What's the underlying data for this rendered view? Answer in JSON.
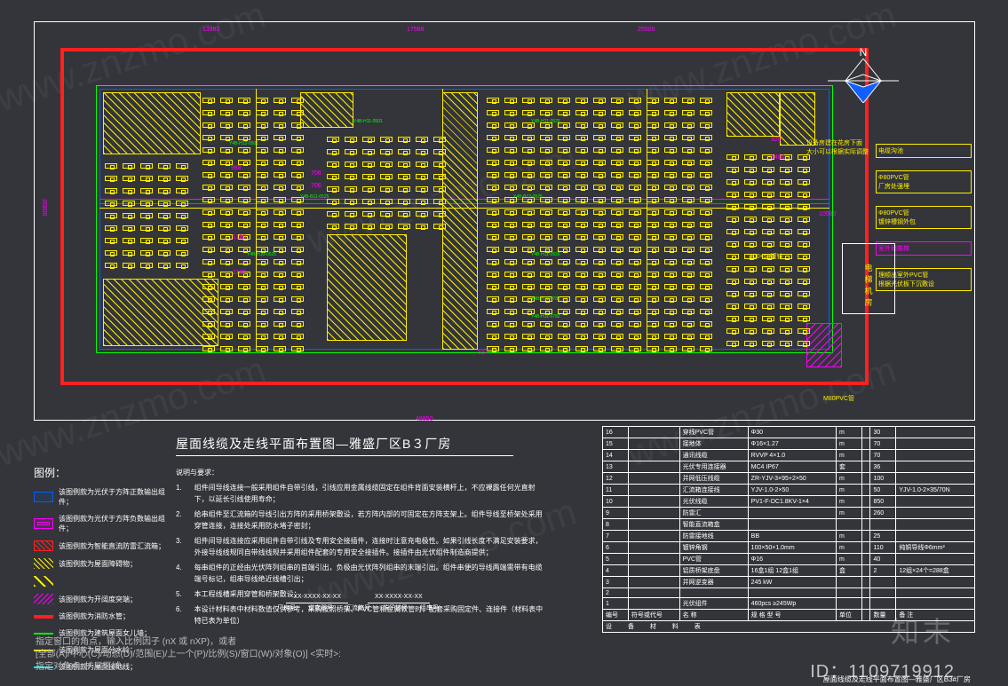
{
  "compass_label": "N",
  "drawing": {
    "dims": {
      "top1": "13382",
      "top2": "17568",
      "top3": "25500",
      "bottom": "48850",
      "left": "26800"
    },
    "wire_labels": [
      "Y4B-H11-0501",
      "Y4B-H12-0501",
      "Y4B-H11-0525",
      "Y4B-B11-0525",
      "Y4B-B12-0525",
      "Y4B-H10-0525",
      "Y4B-H11-0526",
      "Y4B-H11-0781",
      "Y4B-H11-0782"
    ],
    "inline_dims": [
      "988",
      "1180",
      "1180",
      "1400",
      "706",
      "706",
      "320",
      "537",
      "10580",
      "100×50镀锌"
    ],
    "equipment_note": "设备房建在花房下面\n大小可以根据实际调整",
    "right_call1": "电缆沟池",
    "right_call2": "Φ80PVC管\n厂房处强埋",
    "right_call3": "Φ80PVC管\n镀锌槽钢外包",
    "right_call4": "室外墙檐梯",
    "right_call5": "理顺出室外PVC管\n根据光伏板下沉敷设",
    "machine_room": "电\n梯\n机\n房",
    "m80": "M80PVC管"
  },
  "title": "屋面线缆及走线平面布置图—雅盛厂区B３厂房",
  "legend": {
    "header": "图例：",
    "items": [
      "该图例款为光伏于方阵正数输出组件；",
      "该图例款为光伏于方阵负数输出组件；",
      "该图例款为智能直流防雷汇流箱；",
      "该图例款为屋面障碍物；",
      "",
      "该图例款为开阔度突端；",
      "该图例款为消防水管；",
      "该图例款为建筑屋面女儿墙；",
      "该图例款为屋面分水岭；",
      "该图例款为屋面接地线；"
    ]
  },
  "notes": {
    "header": "说明与要求：",
    "items": [
      "组件间导线连接一般采用组件自带引线，引线应用金属线缆固定在组件背面安装横杆上，不应裸露任何光直射下，以延长引线使用寿命；",
      "给串组件至汇流箱的导线引出方阵的采用桥架敷设，若方阵内部的可固定在方阵支架上。组件导线至桥架处采用穿管连接，连接处采用防水堵子密封；",
      "组件间导线连接应采用组件自带引线及专用安全接插件，连接时注意充电极性。如果引线长度不满足安装要求，外接导线线规同自带线线规并采用组件配套的专用安全接插件。接插件由光伏组件制造商提供；",
      "每串组件的正经由光伏阵列组串的首端引出，负极由光伏阵列组串的末端引出。组件串便的导线两端需带有电缆端号标记，组串导线绝近线槽引出；",
      "本工程线槽采用穿管和桥架敷设；",
      "本设计材料表中材料数值仅供参考，采购按照桥架、PVC管和金属软管时，配套采购固定件、连接件（材料表中特已表为单位）"
    ]
  },
  "cable_schema": {
    "pattern": "XX-XXXX-XX-XX",
    "tag1": "厂房号",
    "tag2": "逆变器号",
    "tag3": "汇流箱号",
    "tag4": "端子排号",
    "tag5": "组串号"
  },
  "material": {
    "title": "设 备 材 料 表",
    "headers": [
      "编号",
      "符号或代号",
      "名 称",
      "规 格 型 号",
      "单位",
      "",
      "数量",
      "备 注"
    ],
    "rows": [
      {
        "n": "16",
        "name": "穿线PVC管",
        "spec": "Φ30",
        "u": "m",
        "q": "30"
      },
      {
        "n": "15",
        "name": "接地体",
        "spec": "Φ16×1.27",
        "u": "m",
        "q": "70"
      },
      {
        "n": "14",
        "name": "通讯线缆",
        "spec": "RVVP 4×1.0",
        "u": "m",
        "q": "70"
      },
      {
        "n": "13",
        "name": "光伏专用连接器",
        "spec": "MC4 IP67",
        "u": "套",
        "q": "36"
      },
      {
        "n": "12",
        "name": "并网低压线缆",
        "spec": "ZR-YJV-3×95+2×50",
        "u": "m",
        "q": "100",
        "r": ""
      },
      {
        "n": "11",
        "name": "汇流箱连接线",
        "spec": "YJV-1.0-2×50",
        "u": "m",
        "q": "50",
        "r": "YJV-1.0-2×35/70N"
      },
      {
        "n": "10",
        "name": "光伏线缆",
        "spec": "PV1-F-DC1.8KV-1×4",
        "u": "m",
        "q": "850"
      },
      {
        "n": "9",
        "name": "防雷汇",
        "spec": "",
        "u": "m",
        "q": "260"
      },
      {
        "n": "8",
        "name": "智能直流箱盒",
        "spec": "",
        "u": "",
        "q": ""
      },
      {
        "n": "7",
        "name": "防雷接地线",
        "spec": "BB",
        "u": "m",
        "q": "25"
      },
      {
        "n": "6",
        "name": "镀锌角钢",
        "spec": "100×50×1.0mm",
        "u": "m",
        "q": "110",
        "r": "纯铜导线Φ6mm²"
      },
      {
        "n": "5",
        "name": "PVC管",
        "spec": "Φ16",
        "u": "m",
        "q": "40"
      },
      {
        "n": "4",
        "name": "铝质桥架底盘",
        "spec": "16盒1组 12盒1组",
        "u": "盒",
        "q": "2",
        "r": "12组×24个=288盒"
      },
      {
        "n": "3",
        "name": "并网逆变器",
        "spec": "245 kW",
        "u": "",
        "q": ""
      },
      {
        "n": "2",
        "name": "",
        "spec": "",
        "u": "",
        "q": ""
      },
      {
        "n": "1",
        "name": "光伏组件",
        "spec": "460pcs ≥245Wp",
        "u": "",
        "q": ""
      }
    ]
  },
  "cmdbar": {
    "l1": "指定窗口的角点，输入比例因子 (nX 或 nXP)，或者",
    "l2": "[全部(A)/中心(C)/动态(D)/范围(E)/上一个(P)/比例(S)/窗口(W)/对象(O)] <实时>:",
    "l3": "指定对角点: 扩展区域。"
  },
  "overlay": {
    "watermark": "www.znzmo.com",
    "logo": "知末",
    "id": "ID：1109719912"
  },
  "sheet_name": "屋面线缆及走线平面布置图—雅盛厂区B3#厂房"
}
